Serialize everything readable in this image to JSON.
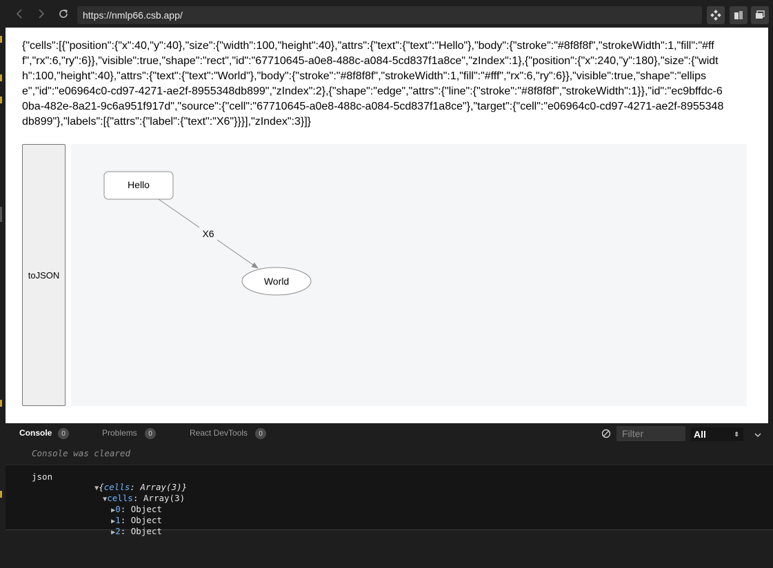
{
  "browser": {
    "url": "https://nmlp66.csb.app/"
  },
  "page": {
    "json_output": "{\"cells\":[{\"position\":{\"x\":40,\"y\":40},\"size\":{\"width\":100,\"height\":40},\"attrs\":{\"text\":{\"text\":\"Hello\"},\"body\":{\"stroke\":\"#8f8f8f\",\"strokeWidth\":1,\"fill\":\"#fff\",\"rx\":6,\"ry\":6}},\"visible\":true,\"shape\":\"rect\",\"id\":\"67710645-a0e8-488c-a084-5cd837f1a8ce\",\"zIndex\":1},{\"position\":{\"x\":240,\"y\":180},\"size\":{\"width\":100,\"height\":40},\"attrs\":{\"text\":{\"text\":\"World\"},\"body\":{\"stroke\":\"#8f8f8f\",\"strokeWidth\":1,\"fill\":\"#fff\",\"rx\":6,\"ry\":6}},\"visible\":true,\"shape\":\"ellipse\",\"id\":\"e06964c0-cd97-4271-ae2f-8955348db899\",\"zIndex\":2},{\"shape\":\"edge\",\"attrs\":{\"line\":{\"stroke\":\"#8f8f8f\",\"strokeWidth\":1}},\"id\":\"ec9bffdc-60ba-482e-8a21-9c6a951f917d\",\"source\":{\"cell\":\"67710645-a0e8-488c-a084-5cd837f1a8ce\"},\"target\":{\"cell\":\"e06964c0-cd97-4271-ae2f-8955348db899\"},\"labels\":[{\"attrs\":{\"label\":{\"text\":\"X6\"}}}],\"zIndex\":3}]}",
    "tojson_label": "toJSON",
    "graph": {
      "node_hello": "Hello",
      "node_world": "World",
      "edge_label": "X6",
      "stroke_color": "#8f8f8f",
      "canvas_bg": "#f4f6f8"
    }
  },
  "devtools": {
    "tabs": [
      {
        "label": "Console",
        "count": "0"
      },
      {
        "label": "Problems",
        "count": "0"
      },
      {
        "label": "React DevTools",
        "count": "0"
      }
    ],
    "filter_placeholder": "Filter",
    "level": "All",
    "cleared_message": "Console was cleared",
    "log": {
      "key": "json",
      "summary_key": "cells",
      "summary_value": "Array(3)",
      "cells_key": "cells",
      "cells_value": "Array(3)",
      "items": [
        {
          "index": "0",
          "value": "Object"
        },
        {
          "index": "1",
          "value": "Object"
        },
        {
          "index": "2",
          "value": "Object"
        }
      ]
    }
  }
}
